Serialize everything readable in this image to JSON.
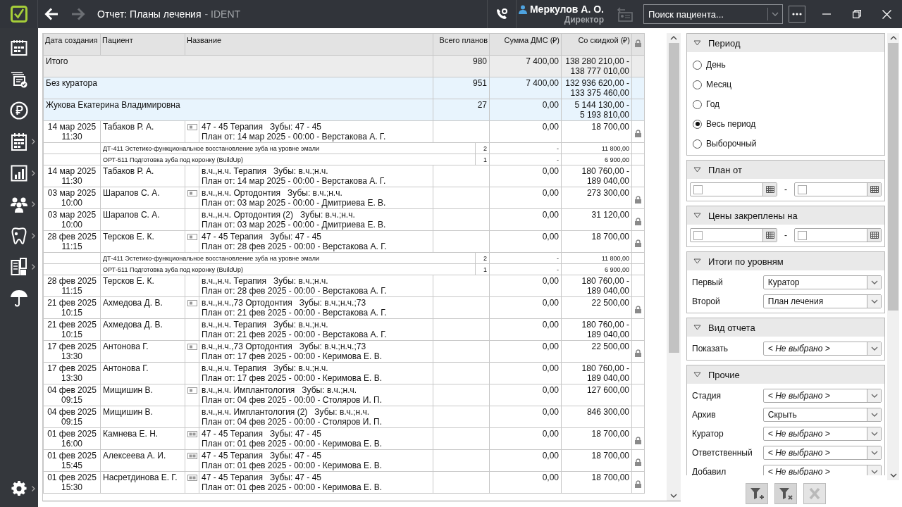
{
  "window": {
    "title": "Отчет: Планы лечения",
    "app": "- IDENT"
  },
  "navigation": {
    "back_disabled": false,
    "forward_disabled": true
  },
  "user": {
    "name": "Меркулов А. О.",
    "role": "Директор"
  },
  "search": {
    "placeholder": "Поиск пациента..."
  },
  "sidebar": {
    "items": [
      {
        "expandable": false
      },
      {
        "expandable": false
      },
      {
        "expandable": false
      },
      {
        "expandable": true
      },
      {
        "expandable": true
      },
      {
        "expandable": true
      },
      {
        "expandable": true
      },
      {
        "expandable": true
      },
      {
        "expandable": false
      },
      {
        "expandable": true
      }
    ]
  },
  "table": {
    "columns": [
      "Дата создания",
      "Пациент",
      "Название",
      "Всего планов",
      "Сумма ДМС (₽)",
      "Со скидкой (₽)"
    ],
    "rows": [
      {
        "kind": "total",
        "label": "Итого",
        "total": "980",
        "dms": "7 400,00",
        "discount": [
          "138 280 210,00 -",
          "138 777 010,00"
        ]
      },
      {
        "kind": "group",
        "label": "Без куратора",
        "total": "951",
        "dms": "7 400,00",
        "discount": [
          "132 936 620,00 -",
          "133 375 460,00"
        ]
      },
      {
        "kind": "group",
        "label": "Жукова Екатерина Владимировна",
        "total": "27",
        "dms": "0,00",
        "discount": [
          "5 144 130,00 -",
          "5 193 810,00"
        ]
      },
      {
        "kind": "plan",
        "date": "14 мар 2025",
        "time": "11:30",
        "patient": "Табаков Р. А.",
        "plan_icon": {
          "kind": "single"
        },
        "name": "47 - 45 Терапия",
        "teeth": "Зубы: 47 - 45",
        "plan_line": "План от: 14 мар 2025 - 00:00 - Верстакова А. Г.",
        "dms": "0,00",
        "discount": [
          "18 700,00"
        ],
        "locked": true
      },
      {
        "kind": "item",
        "name": "ДТ-411 Эстетико-функциональное восстановление зуба на уровне эмали",
        "count": "2",
        "dms": "-",
        "discount": [
          "11 800,00"
        ]
      },
      {
        "kind": "item",
        "name": "ОРТ-511 Подготовка зуба под коронку (BuildUp)",
        "count": "1",
        "dms": "-",
        "discount": [
          "6 900,00"
        ]
      },
      {
        "kind": "plan",
        "date": "14 мар 2025",
        "time": "11:30",
        "patient": "Табаков Р. А.",
        "name": "в.ч.,н.ч. Терапия",
        "teeth": "Зубы: в.ч.;н.ч.",
        "plan_line": "План от: 14 мар 2025 - 00:00 - Верстакова А. Г.",
        "dms": "0,00",
        "discount": [
          "180 760,00 -",
          "189 040,00"
        ],
        "locked": false
      },
      {
        "kind": "plan",
        "date": "03 мар 2025",
        "time": "10:00",
        "patient": "Шарапов С. А.",
        "plan_icon": {
          "kind": "single"
        },
        "name": "в.ч.,н.ч. Ортодонтия",
        "teeth": "Зубы: в.ч.;н.ч.",
        "plan_line": "План от: 03 мар 2025 - 00:00 - Дмитриева Е. В.",
        "dms": "0,00",
        "discount": [
          "273 300,00"
        ],
        "locked": true
      },
      {
        "kind": "plan",
        "date": "03 мар 2025",
        "time": "10:00",
        "patient": "Шарапов С. А.",
        "name": "в.ч.,н.ч. Ортодонтия (2)",
        "teeth": "Зубы: в.ч.;н.ч.",
        "plan_line": "План от: 03 мар 2025 - 00:00 - Дмитриева Е. В.",
        "dms": "0,00",
        "discount": [
          "31 120,00"
        ],
        "locked": true
      },
      {
        "kind": "plan",
        "date": "28 фев 2025",
        "time": "11:15",
        "patient": "Терсков Е. К.",
        "plan_icon": {
          "kind": "single"
        },
        "name": "47 - 45 Терапия",
        "teeth": "Зубы: 47 - 45",
        "plan_line": "План от: 28 фев 2025 - 00:00 - Верстакова А. Г.",
        "dms": "0,00",
        "discount": [
          "18 700,00"
        ],
        "locked": true
      },
      {
        "kind": "item",
        "name": "ДТ-411 Эстетико-функциональное восстановление зуба на уровне эмали",
        "count": "2",
        "dms": "-",
        "discount": [
          "11 800,00"
        ]
      },
      {
        "kind": "item",
        "name": "ОРТ-511 Подготовка зуба под коронку (BuildUp)",
        "count": "1",
        "dms": "-",
        "discount": [
          "6 900,00"
        ]
      },
      {
        "kind": "plan",
        "date": "28 фев 2025",
        "time": "11:15",
        "patient": "Терсков Е. К.",
        "name": "в.ч.,н.ч. Терапия",
        "teeth": "Зубы: в.ч.;н.ч.",
        "plan_line": "План от: 28 фев 2025 - 00:00 - Верстакова А. Г.",
        "dms": "0,00",
        "discount": [
          "180 760,00 -",
          "189 040,00"
        ],
        "locked": false
      },
      {
        "kind": "plan",
        "date": "21 фев 2025",
        "time": "10:15",
        "patient": "Ахмедова Д. В.",
        "plan_icon": {
          "kind": "single"
        },
        "name": "в.ч.,н.ч.,73 Ортодонтия",
        "teeth": "Зубы: в.ч.;н.ч.;73",
        "plan_line": "План от: 21 фев 2025 - 00:00 - Верстакова А. Г.",
        "dms": "0,00",
        "discount": [
          "22 500,00"
        ],
        "locked": true
      },
      {
        "kind": "plan",
        "date": "21 фев 2025",
        "time": "10:15",
        "patient": "Ахмедова Д. В.",
        "name": "в.ч.,н.ч. Терапия",
        "teeth": "Зубы: в.ч.;н.ч.",
        "plan_line": "План от: 21 фев 2025 - 00:00 - Верстакова А. Г.",
        "dms": "0,00",
        "discount": [
          "180 760,00 -",
          "189 040,00"
        ],
        "locked": false
      },
      {
        "kind": "plan",
        "date": "17 фев 2025",
        "time": "13:30",
        "patient": "Антонова Г.",
        "plan_icon": {
          "kind": "single"
        },
        "name": "в.ч.,н.ч.,73 Ортодонтия",
        "teeth": "Зубы: в.ч.;н.ч.;73",
        "plan_line": "План от: 17 фев 2025 - 00:00 - Керимова Е. В.",
        "dms": "0,00",
        "discount": [
          "22 500,00"
        ],
        "locked": true
      },
      {
        "kind": "plan",
        "date": "17 фев 2025",
        "time": "13:30",
        "patient": "Антонова Г.",
        "name": "в.ч.,н.ч. Терапия",
        "teeth": "Зубы: в.ч.;н.ч.",
        "plan_line": "План от: 17 фев 2025 - 00:00 - Керимова Е. В.",
        "dms": "0,00",
        "discount": [
          "180 760,00 -",
          "189 040,00"
        ],
        "locked": false
      },
      {
        "kind": "plan",
        "date": "04 фев 2025",
        "time": "09:15",
        "patient": "Мищишин В.",
        "plan_icon": {
          "kind": "single"
        },
        "name": "в.ч.,н.ч. Имплантология",
        "teeth": "Зубы: в.ч.;н.ч.",
        "plan_line": "План от: 04 фев 2025 - 00:00 - Столяров И. П.",
        "dms": "0,00",
        "discount": [
          "127 600,00"
        ],
        "locked": false
      },
      {
        "kind": "plan",
        "date": "04 фев 2025",
        "time": "09:15",
        "patient": "Мищишин В.",
        "name": "в.ч.,н.ч. Имплантология (2)",
        "teeth": "Зубы: в.ч.;н.ч.",
        "plan_line": "План от: 04 фев 2025 - 00:00 - Столяров И. П.",
        "dms": "0,00",
        "discount": [
          "846 300,00"
        ],
        "locked": false
      },
      {
        "kind": "plan",
        "date": "01 фев 2025",
        "time": "16:00",
        "patient": "Камнева Е. Н.",
        "plan_icon": {
          "kind": "double"
        },
        "name": "47 - 45 Терапия",
        "teeth": "Зубы: 47 - 45",
        "plan_line": "План от: 01 фев 2025 - 00:00 - Керимова Е. В.",
        "dms": "0,00",
        "discount": [
          "18 700,00"
        ],
        "locked": true
      },
      {
        "kind": "plan",
        "date": "01 фев 2025",
        "time": "15:45",
        "patient": "Алексеева А. И.",
        "plan_icon": {
          "kind": "double"
        },
        "name": "47 - 45 Терапия",
        "teeth": "Зубы: 47 - 45",
        "plan_line": "План от: 01 фев 2025 - 00:00 - Керимова Е. В.",
        "dms": "0,00",
        "discount": [
          "18 700,00"
        ],
        "locked": true
      },
      {
        "kind": "plan",
        "date": "01 фев 2025",
        "time": "15:30",
        "patient": "Насретдинова Е. Г.",
        "plan_icon": {
          "kind": "double"
        },
        "name": "47 - 45 Терапия",
        "teeth": "Зубы: 47 - 45",
        "plan_line": "План от: 01 фев 2025 - 00:00 - Керимова Е. В.",
        "dms": "0,00",
        "discount": [
          "18 700,00"
        ],
        "locked": true
      }
    ]
  },
  "filters": {
    "sections": [
      {
        "kind": "radio",
        "title": "Период",
        "options": [
          {
            "label": "День",
            "selected": false
          },
          {
            "label": "Месяц",
            "selected": false
          },
          {
            "label": "Год",
            "selected": false
          },
          {
            "label": "Весь период",
            "selected": true
          },
          {
            "label": "Выборочный",
            "selected": false
          }
        ]
      },
      {
        "kind": "date_range",
        "title": "План от",
        "from": {
          "checked": false
        },
        "separator": "-",
        "to": {
          "checked": false
        }
      },
      {
        "kind": "date_range",
        "title": "Цены закреплены на",
        "from": {
          "checked": false
        },
        "separator": "-",
        "to": {
          "checked": false
        }
      },
      {
        "kind": "fields",
        "title": "Итоги по уровням",
        "fields": [
          {
            "label": "Первый",
            "value": "Куратор",
            "empty": false
          },
          {
            "label": "Второй",
            "value": "План лечения",
            "empty": false
          }
        ]
      },
      {
        "kind": "fields",
        "title": "Вид отчета",
        "fields": [
          {
            "label": "Показать",
            "value": "< Не выбрано >",
            "empty": true
          }
        ]
      },
      {
        "kind": "fields",
        "title": "Прочие",
        "fields": [
          {
            "label": "Стадия",
            "value": "< Не выбрано >",
            "empty": true
          },
          {
            "label": "Архив",
            "value": "Скрыть",
            "empty": false
          },
          {
            "label": "Куратор",
            "value": "< Не выбрано >",
            "empty": true
          },
          {
            "label": "Ответственный",
            "value": "< Не выбрано >",
            "empty": true
          },
          {
            "label": "Добавил",
            "value": "< Не выбрано >",
            "empty": true
          }
        ]
      }
    ],
    "buttons": [
      {
        "kind": "add_filter",
        "disabled": false
      },
      {
        "kind": "clear_filter",
        "disabled": false
      },
      {
        "kind": "reset",
        "disabled": true
      }
    ]
  }
}
